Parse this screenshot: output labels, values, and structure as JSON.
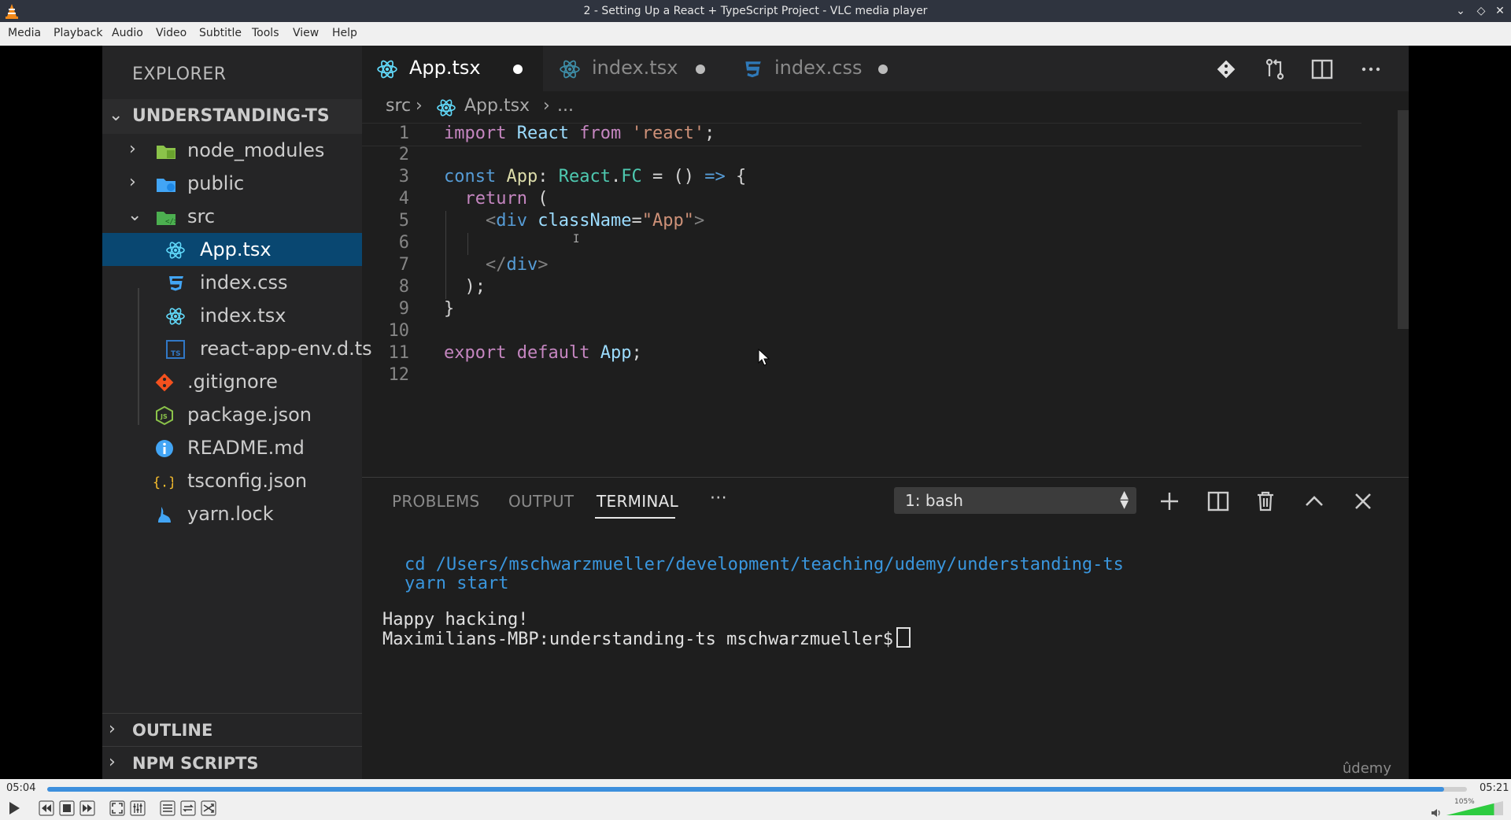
{
  "window": {
    "title": "2 - Setting Up a React + TypeScript Project - VLC media player"
  },
  "menu": [
    "Media",
    "Playback",
    "Audio",
    "Video",
    "Subtitle",
    "Tools",
    "View",
    "Help"
  ],
  "vscode": {
    "explorer_title": "EXPLORER",
    "project": "UNDERSTANDING-TS",
    "tree": [
      {
        "label": "node_modules",
        "icon": "folder-node-icon",
        "kind": "folder-collapsed"
      },
      {
        "label": "public",
        "icon": "folder-public-icon",
        "kind": "folder-collapsed"
      },
      {
        "label": "src",
        "icon": "folder-src-icon",
        "kind": "folder-expanded"
      },
      {
        "label": "App.tsx",
        "icon": "react-icon",
        "kind": "file",
        "active": true
      },
      {
        "label": "index.css",
        "icon": "css-icon",
        "kind": "file"
      },
      {
        "label": "index.tsx",
        "icon": "react-icon",
        "kind": "file"
      },
      {
        "label": "react-app-env.d.ts",
        "icon": "typescript-icon",
        "kind": "file"
      },
      {
        "label": ".gitignore",
        "icon": "git-icon",
        "kind": "file"
      },
      {
        "label": "package.json",
        "icon": "nodejs-icon",
        "kind": "file"
      },
      {
        "label": "README.md",
        "icon": "info-icon",
        "kind": "file"
      },
      {
        "label": "tsconfig.json",
        "icon": "json-braces-icon",
        "kind": "file"
      },
      {
        "label": "yarn.lock",
        "icon": "yarn-icon",
        "kind": "file"
      }
    ],
    "sections": [
      "OUTLINE",
      "NPM SCRIPTS"
    ],
    "tabs": [
      {
        "label": "App.tsx",
        "icon": "react-icon",
        "active": true
      },
      {
        "label": "index.tsx",
        "icon": "react-icon",
        "active": false
      },
      {
        "label": "index.css",
        "icon": "css-icon",
        "active": false
      }
    ],
    "breadcrumb": {
      "folder": "src",
      "file": "App.tsx",
      "more": "..."
    },
    "line_numbers": [
      "1",
      "2",
      "3",
      "4",
      "5",
      "6",
      "7",
      "8",
      "9",
      "10",
      "11",
      "12"
    ],
    "panel": {
      "tabs": [
        "PROBLEMS",
        "OUTPUT",
        "TERMINAL"
      ],
      "active_tab": "TERMINAL",
      "more": "···",
      "terminal_select": "1: bash",
      "lines": [
        {
          "text": "cd /Users/mschwarzmueller/development/teaching/udemy/understanding-ts",
          "type": "cmd"
        },
        {
          "text": "yarn start",
          "type": "cmd"
        },
        {
          "text": "Happy hacking!",
          "type": "out"
        },
        {
          "text": "Maximilians-MBP:understanding-ts mschwarzmueller$",
          "type": "out"
        }
      ],
      "watermark": "ûdemy"
    }
  },
  "player": {
    "elapsed": "05:04",
    "total": "05:21",
    "progress": 0.984,
    "volume_label": "105%",
    "volume_level": 1.05
  },
  "colors": {
    "selection": "#094771",
    "accent_blue": "#3d8fdd",
    "terminal_cmd": "#3a96dd"
  }
}
